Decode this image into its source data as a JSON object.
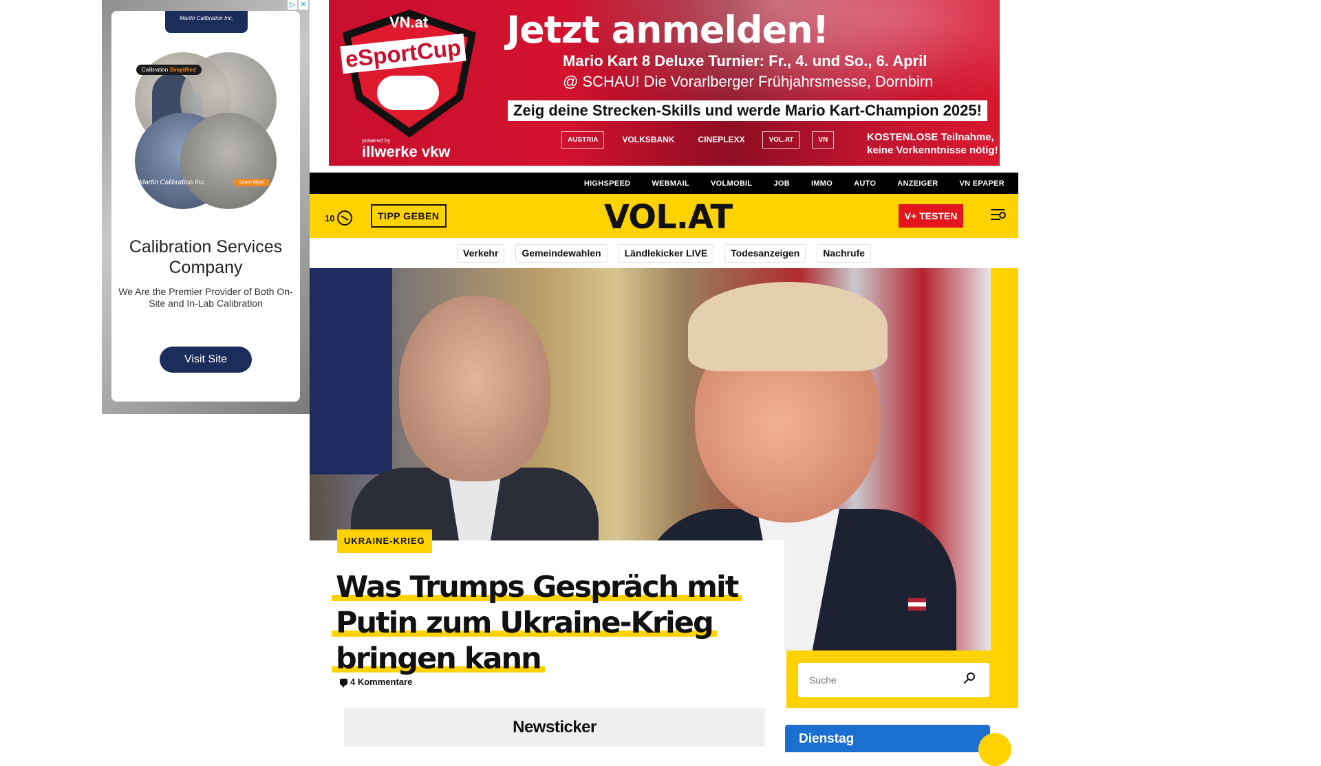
{
  "side_ad": {
    "logo_text": "Martin Calibration Inc.",
    "tag_brand": "Calibration",
    "tag_highlight": "Simplified",
    "circle_brand": "Martin Calibration Inc.",
    "circle_button": "Learn More",
    "headline": "Calibration Services Company",
    "subtext": "We Are the Premier Provider of Both On-Site and In-Lab Calibration",
    "cta": "Visit Site",
    "choices_info": "▷",
    "choices_close": "✕"
  },
  "top_banner": {
    "shield_top": "VN.at",
    "shield_main": "eSportCup",
    "powered_by": "powered by",
    "powered_brand": "illwerke vkw",
    "title": "Jetzt anmelden!",
    "line1": "Mario Kart 8 Deluxe Turnier: Fr., 4. und So., 6. April",
    "line2": "@ SCHAU! Die Vorarlberger Frühjahrsmesse, Dornbirn",
    "boxed_line": "Zeig deine Strecken-Skills und werde Mario Kart-Champion 2025!",
    "sponsors": [
      "AUSTRIA",
      "VOLKSBANK",
      "CINEPLEXX",
      "VOL.AT",
      "VN"
    ],
    "free_note_1": "KOSTENLOSE Teilnahme,",
    "free_note_2": "keine Vorkenntnisse nötig!"
  },
  "top_nav": {
    "items": [
      "HIGHSPEED",
      "WEBMAIL",
      "VOLMOBIL",
      "JOB",
      "IMMO",
      "AUTO",
      "ANZEIGER",
      "VN EPAPER"
    ]
  },
  "header": {
    "temperature": "10",
    "tipp_label": "TIPP GEBEN",
    "logo": "VOL.AT",
    "vtest_label": "V+ TESTEN"
  },
  "topics": [
    "Verkehr",
    "Gemeindewahlen",
    "Ländlekicker LIVE",
    "Todesanzeigen",
    "Nachrufe"
  ],
  "article": {
    "kicker": "UKRAINE-KRIEG",
    "headline": "Was Trumps Gespräch mit Putin zum Ukraine-Krieg bringen kann",
    "comments": "4 Kommentare",
    "newsticker": "Newsticker"
  },
  "sidebar": {
    "search_placeholder": "Suche",
    "weather_day": "Dienstag"
  },
  "colors": {
    "brand_yellow": "#ffd200",
    "accent_red": "#e3161e",
    "weather_blue": "#1a6fd0"
  }
}
